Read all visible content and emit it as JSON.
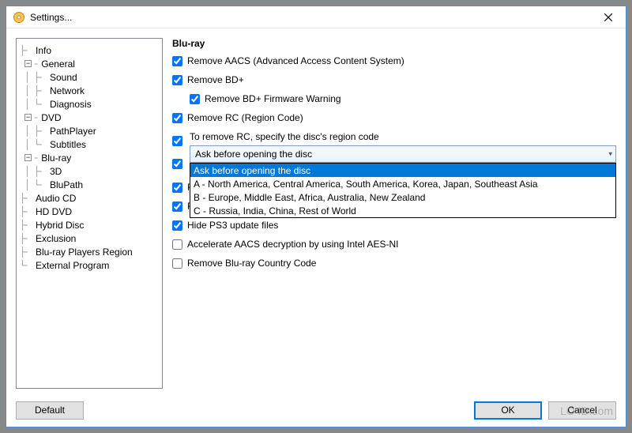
{
  "window": {
    "title": "Settings..."
  },
  "tree": {
    "items": [
      {
        "label": "Info",
        "depth": 0,
        "expandable": false
      },
      {
        "label": "General",
        "depth": 0,
        "expandable": true,
        "expanded": true
      },
      {
        "label": "Sound",
        "depth": 1,
        "expandable": false
      },
      {
        "label": "Network",
        "depth": 1,
        "expandable": false
      },
      {
        "label": "Diagnosis",
        "depth": 1,
        "expandable": false
      },
      {
        "label": "DVD",
        "depth": 0,
        "expandable": true,
        "expanded": true
      },
      {
        "label": "PathPlayer",
        "depth": 1,
        "expandable": false
      },
      {
        "label": "Subtitles",
        "depth": 1,
        "expandable": false
      },
      {
        "label": "Blu-ray",
        "depth": 0,
        "expandable": true,
        "expanded": true
      },
      {
        "label": "3D",
        "depth": 1,
        "expandable": false
      },
      {
        "label": "BluPath",
        "depth": 1,
        "expandable": false
      },
      {
        "label": "Audio CD",
        "depth": 0,
        "expandable": false
      },
      {
        "label": "HD DVD",
        "depth": 0,
        "expandable": false
      },
      {
        "label": "Hybrid Disc",
        "depth": 0,
        "expandable": false
      },
      {
        "label": "Exclusion",
        "depth": 0,
        "expandable": false
      },
      {
        "label": "Blu-ray Players Region",
        "depth": 0,
        "expandable": false
      },
      {
        "label": "External Program",
        "depth": 0,
        "expandable": false
      }
    ]
  },
  "section": {
    "title": "Blu-ray"
  },
  "checks": {
    "aacs": {
      "label": "Remove AACS (Advanced Access Content System)",
      "checked": true
    },
    "bdplus": {
      "label": "Remove BD+",
      "checked": true
    },
    "bdplus_fw": {
      "label": "Remove BD+ Firmware Warning",
      "checked": true
    },
    "rc": {
      "label": "Remove RC (Region Code)",
      "checked": true
    },
    "rc_hint": "To remove RC, specify the disc's region code",
    "hidden1": {
      "label": "",
      "checked": true
    },
    "hidden2": {
      "label": "",
      "checked": true
    },
    "uops": {
      "label": "Remove UOPs (User Operation Prohibitions)",
      "checked": true
    },
    "cci": {
      "label": "Remove CCI (Copy Control Information)",
      "checked": true
    },
    "ps3": {
      "label": "Hide PS3 update files",
      "checked": true
    },
    "aesni": {
      "label": "Accelerate AACS decryption by using Intel AES-NI",
      "checked": false
    },
    "country": {
      "label": "Remove Blu-ray Country Code",
      "checked": false
    }
  },
  "dropdown": {
    "selected": "Ask before opening the disc",
    "options": [
      "Ask before opening the disc",
      "A - North America, Central America, South America, Korea, Japan, Southeast Asia",
      "B - Europe, Middle East, Africa, Australia, New Zealand",
      "C - Russia, India, China, Rest of World"
    ]
  },
  "buttons": {
    "default": "Default",
    "ok": "OK",
    "cancel": "Cancel"
  },
  "watermark": "LO4D.com"
}
